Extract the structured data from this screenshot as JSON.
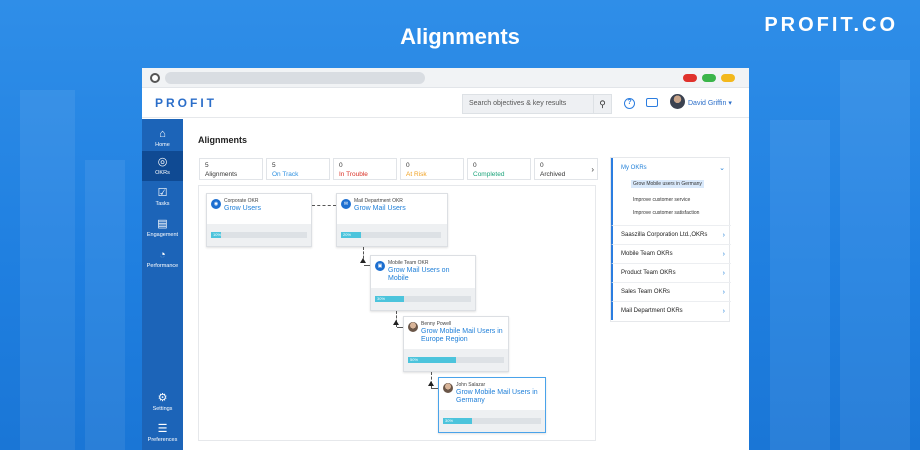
{
  "promo": {
    "headline": "Alignments",
    "brand": "PROFIT.CO"
  },
  "app": {
    "logo": "PROFIT",
    "search_placeholder": "Search objectives & key results",
    "user_name": "David Griffin",
    "page_title": "Alignments"
  },
  "sidebar": {
    "items": [
      {
        "label": "Home",
        "icon": "home-icon",
        "glyph": "⌂"
      },
      {
        "label": "OKRs",
        "icon": "target-icon",
        "glyph": "◎"
      },
      {
        "label": "Tasks",
        "icon": "checkbox-icon",
        "glyph": "☑"
      },
      {
        "label": "Engagement",
        "icon": "message-icon",
        "glyph": "▤"
      },
      {
        "label": "Performance",
        "icon": "gauge-icon",
        "glyph": "◔"
      },
      {
        "label": "Settings",
        "icon": "gear-icon",
        "glyph": "⚙"
      },
      {
        "label": "Preferences",
        "icon": "sliders-icon",
        "glyph": "☰"
      }
    ]
  },
  "stats": [
    {
      "count": "5",
      "label": "Alignments",
      "color": "#333333"
    },
    {
      "count": "5",
      "label": "On Track",
      "color": "#2b8fe0"
    },
    {
      "count": "0",
      "label": "In Trouble",
      "color": "#d93025"
    },
    {
      "count": "0",
      "label": "At Risk",
      "color": "#f0a020"
    },
    {
      "count": "0",
      "label": "Completed",
      "color": "#1aa37a"
    },
    {
      "count": "0",
      "label": "Archived",
      "color": "#333333"
    }
  ],
  "okr_cards": [
    {
      "owner": "Corporate OKR",
      "title": "Grow Users",
      "progress": 0.1,
      "percent": "10%"
    },
    {
      "owner": "Mail Department OKR",
      "title": "Grow Mail Users",
      "progress": 0.2,
      "percent": "20%"
    },
    {
      "owner": "Mobile Team OKR",
      "title": "Grow Mail Users on Mobile",
      "progress": 0.3,
      "percent": "30%"
    },
    {
      "owner": "Benny Powell",
      "title": "Grow Mobile Mail Users in Europe Region",
      "progress": 0.5,
      "percent": "50%"
    },
    {
      "owner": "John Salazar",
      "title": "Grow Mobile Mail Users in Germany",
      "progress": 0.3,
      "percent": "30%"
    }
  ],
  "right_panel": {
    "my_okrs_label": "My OKRs",
    "my_okrs_items": [
      "Grow Mobile users in Germany",
      "Improve customer service",
      "Improve customer satisfaction"
    ],
    "groups": [
      "Saaszilla Corporation Ltd.,OKRs",
      "Mobile Team OKRs",
      "Product Team OKRs",
      "Sales Team OKRs",
      "Mail Department OKRs"
    ]
  },
  "colors": {
    "accent": "#1f7fd8",
    "sidebar": "#1c64b8",
    "progress": "#4cc4dc"
  }
}
